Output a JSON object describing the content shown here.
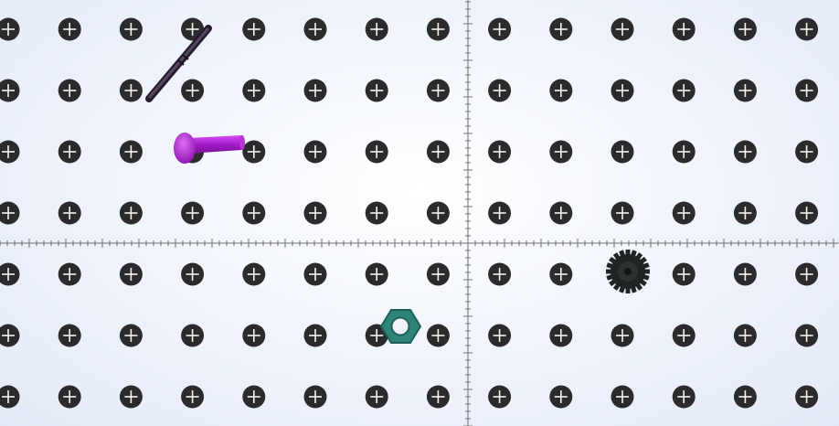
{
  "scene": {
    "kind": "pegboard",
    "background_color": "#eef3fb",
    "peg_color": "#2b2b2e",
    "peg_cross_color": "#f4f4f4",
    "axis_color": "#6f6f6f",
    "grid": {
      "columns": 14,
      "rows": 7
    }
  },
  "objects": [
    {
      "id": "rod",
      "name": "rod",
      "color": "#3a2f45"
    },
    {
      "id": "pin",
      "name": "bolt/pin",
      "color": "#a41bc9"
    },
    {
      "id": "gear",
      "name": "gear",
      "color": "#1f2424"
    },
    {
      "id": "hex-nut",
      "name": "hex nut",
      "color": "#2f8378"
    }
  ]
}
